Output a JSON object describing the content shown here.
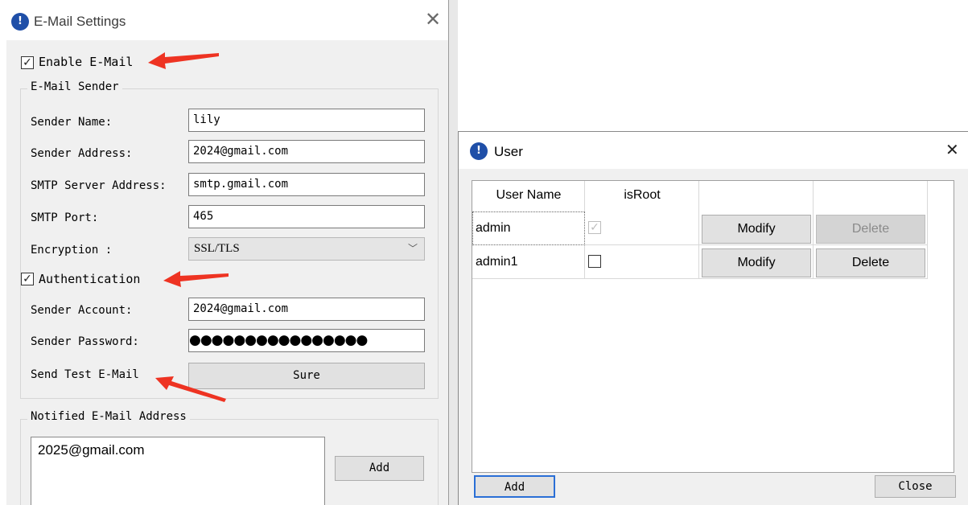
{
  "email_window": {
    "title": "E-Mail Settings",
    "enable_email": {
      "label": "Enable E-Mail",
      "checked": true
    },
    "sender_group": {
      "title": "E-Mail Sender",
      "sender_name": {
        "label": "Sender Name:",
        "value": "lily"
      },
      "sender_address": {
        "label": "Sender Address:",
        "value": "2024@gmail.com"
      },
      "smtp_server": {
        "label": "SMTP Server Address:",
        "value": "smtp.gmail.com"
      },
      "smtp_port": {
        "label": "SMTP Port:",
        "value": "465"
      },
      "encryption": {
        "label": "Encryption :",
        "value": "SSL/TLS"
      },
      "authentication": {
        "label": "Authentication",
        "checked": true
      },
      "sender_account": {
        "label": "Sender Account:",
        "value": "2024@gmail.com"
      },
      "sender_password": {
        "label": "Sender Password:",
        "value": "●●●●●●●●●●●●●●●●"
      },
      "send_test": {
        "label": "Send Test E-Mail",
        "button": "Sure"
      }
    },
    "notified_group": {
      "title": "Notified E-Mail Address",
      "addresses": [
        "2025@gmail.com"
      ],
      "add_button": "Add"
    }
  },
  "user_window": {
    "title": "User",
    "columns": [
      "User Name",
      "isRoot",
      "",
      ""
    ],
    "rows": [
      {
        "name": "admin",
        "is_root": true,
        "modify": "Modify",
        "delete": "Delete",
        "delete_enabled": false
      },
      {
        "name": "admin1",
        "is_root": false,
        "modify": "Modify",
        "delete": "Delete",
        "delete_enabled": true
      }
    ],
    "add_button": "Add",
    "close_button": "Close"
  },
  "colors": {
    "arrow": "#ee3322",
    "app_logo": "#1f4fa8"
  },
  "icons": {
    "app": "app-logo-icon",
    "close": "close-icon",
    "dropdown": "chevron-down-icon",
    "checkbox": "checkmark-icon"
  }
}
